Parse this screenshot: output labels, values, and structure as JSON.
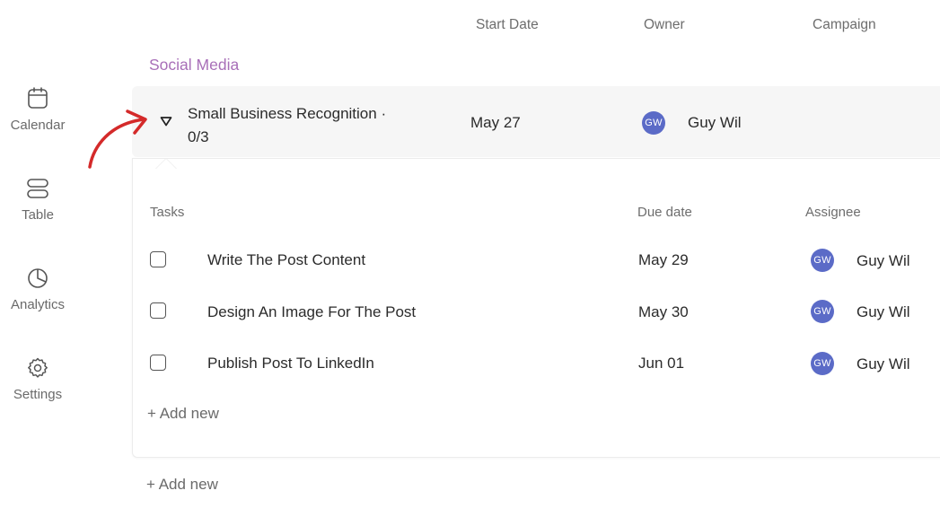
{
  "sidebar": {
    "items": [
      {
        "label": "Calendar",
        "icon": "calendar-icon"
      },
      {
        "label": "Table",
        "icon": "table-icon"
      },
      {
        "label": "Analytics",
        "icon": "pie-chart-icon"
      },
      {
        "label": "Settings",
        "icon": "gear-icon"
      }
    ]
  },
  "columns": {
    "start_date": "Start Date",
    "owner": "Owner",
    "campaign": "Campaign"
  },
  "group": {
    "title": "Social Media",
    "title_color": "#a86fb8"
  },
  "project": {
    "name": "Small Business Recognition ·",
    "progress": "0/3",
    "start_date": "May 27",
    "owner_initials": "GW",
    "owner_name": "Guy Wil"
  },
  "subtasks": {
    "headers": {
      "tasks": "Tasks",
      "due_date": "Due date",
      "assignee": "Assignee"
    },
    "rows": [
      {
        "name": "Write The Post Content",
        "due": "May 29",
        "initials": "GW",
        "assignee": "Guy Wil",
        "checked": false
      },
      {
        "name": "Design An Image For The Post",
        "due": "May 30",
        "initials": "GW",
        "assignee": "Guy Wil",
        "checked": false
      },
      {
        "name": "Publish Post To LinkedIn",
        "due": "Jun 01",
        "initials": "GW",
        "assignee": "Guy Wil",
        "checked": false
      }
    ],
    "add_new": "+ Add new"
  },
  "group_add_new": "+ Add new",
  "colors": {
    "avatar": "#5b6bc7",
    "annotation_arrow": "#d42a2a"
  }
}
